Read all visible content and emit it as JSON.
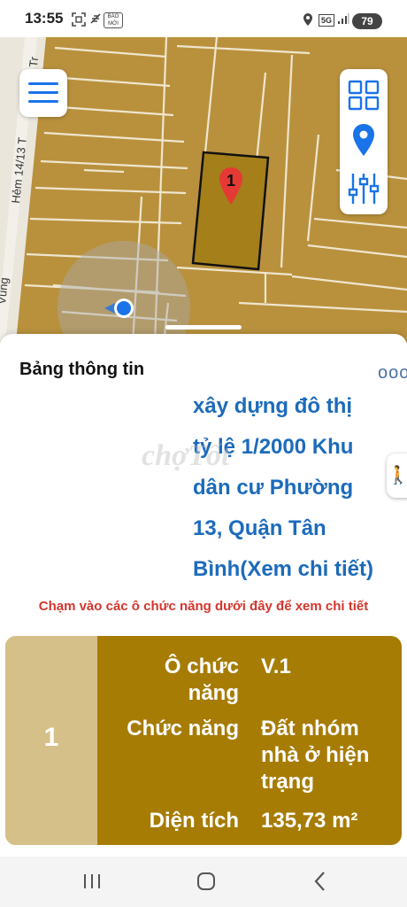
{
  "status_bar": {
    "time": "13:55",
    "news_badge": "BÁO MỚI",
    "network": "5G",
    "battery": "79"
  },
  "map": {
    "street_labels": [
      "Hẻm 14/13 T",
      "ân Tr",
      "Vùng"
    ],
    "marker_label": "1",
    "colors": {
      "land": "#b9913d",
      "parcel_selected": "#a47f1a",
      "street": "#eae6dc",
      "marker": "#e53935"
    }
  },
  "info_panel": {
    "title": "Bảng thông tin",
    "more_label": "ooo",
    "description_lines": [
      "xây dựng đô thị",
      "tỷ lệ 1/2000 Khu",
      "dân cư Phường",
      "13, Quận Tân",
      "Bình(Xem chi tiết)"
    ],
    "watermark": "chợTốt",
    "hint": "Chạm vào các ô chức năng dưới đây để xem chi tiết"
  },
  "parcel_card": {
    "number": "1",
    "rows": [
      {
        "label": "Ô chức năng",
        "value": "V.1"
      },
      {
        "label": "Chức năng",
        "value": "Đất nhóm nhà ở hiện trạng"
      },
      {
        "label": "Diện tích",
        "value": "135,73 m²"
      }
    ],
    "colors": {
      "left": "#d6c08a",
      "main": "#a77c05"
    }
  }
}
